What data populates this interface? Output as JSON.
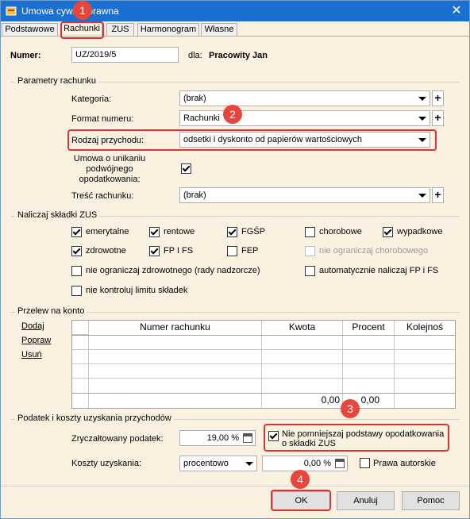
{
  "window": {
    "title": "Umowa cywilnoprawna"
  },
  "tabs": [
    "Podstawowe",
    "Rachunki",
    "ZUS",
    "Harmonogram",
    "Własne"
  ],
  "header": {
    "numer_label": "Numer:",
    "numer_value": "UZ/2019/5",
    "dla_label": "dla:",
    "dla_value": "Pracowity Jan"
  },
  "params": {
    "group": "Parametry rachunku",
    "kategoria_label": "Kategoria:",
    "kategoria_value": "(brak)",
    "format_label": "Format numeru:",
    "format_value": "Rachunki",
    "rodzaj_label": "Rodzaj przychodu:",
    "rodzaj_value": "odsetki i dyskonto od papierów wartościowych",
    "umowa_label": "Umowa o unikaniu podwójnego opodatkowania:",
    "umowa_checked": true,
    "tresc_label": "Treść rachunku:",
    "tresc_value": "(brak)"
  },
  "zus": {
    "group": "Naliczaj składki ZUS",
    "items": [
      {
        "label": "emerytalne",
        "checked": true
      },
      {
        "label": "rentowe",
        "checked": true
      },
      {
        "label": "FGŚP",
        "checked": true
      },
      {
        "label": "chorobowe",
        "checked": false
      },
      {
        "label": "wypadkowe",
        "checked": true
      },
      {
        "label": "zdrowotne",
        "checked": true
      },
      {
        "label": "FP I FS",
        "checked": true
      },
      {
        "label": "FEP",
        "checked": false
      },
      {
        "label": "nie ograniczaj chorobowego",
        "checked": false,
        "disabled": true
      },
      {
        "label": "nie ograniczaj zdrowotnego (rady nadzorcze)",
        "checked": false
      },
      {
        "label": "automatycznie naliczaj FP i FS",
        "checked": false
      },
      {
        "label": "nie kontroluj limitu składek",
        "checked": false
      }
    ]
  },
  "transfer": {
    "group": "Przelew na konto",
    "links": [
      "Dodaj",
      "Popraw",
      "Usuń"
    ],
    "columns": [
      "Numer rachunku",
      "Kwota",
      "Procent",
      "Kolejnoś"
    ],
    "totals": {
      "kwota": "0,00",
      "procent": "0,00"
    }
  },
  "tax": {
    "group": "Podatek i koszty uzyskania przychodów",
    "podatek_label": "Zryczałtowany podatek:",
    "podatek_value": "19,00 %",
    "nie_pomniejszaj_label": "Nie pomniejszaj podstawy opodatkowania o składki ZUS",
    "nie_pomniejszaj_checked": true,
    "koszty_label": "Koszty uzyskania:",
    "koszty_mode": "procentowo",
    "koszty_value": "0,00 %",
    "prawa_label": "Prawa autorskie",
    "prawa_checked": false
  },
  "buttons": {
    "ok": "OK",
    "anuluj": "Anuluj",
    "pomoc": "Pomoc"
  },
  "badges": [
    "1",
    "2",
    "3",
    "4"
  ],
  "colors": {
    "titlebar": "#1b6fd1",
    "highlight": "#e03232",
    "badge": "#e8453c",
    "panel": "#fbf1e1"
  }
}
